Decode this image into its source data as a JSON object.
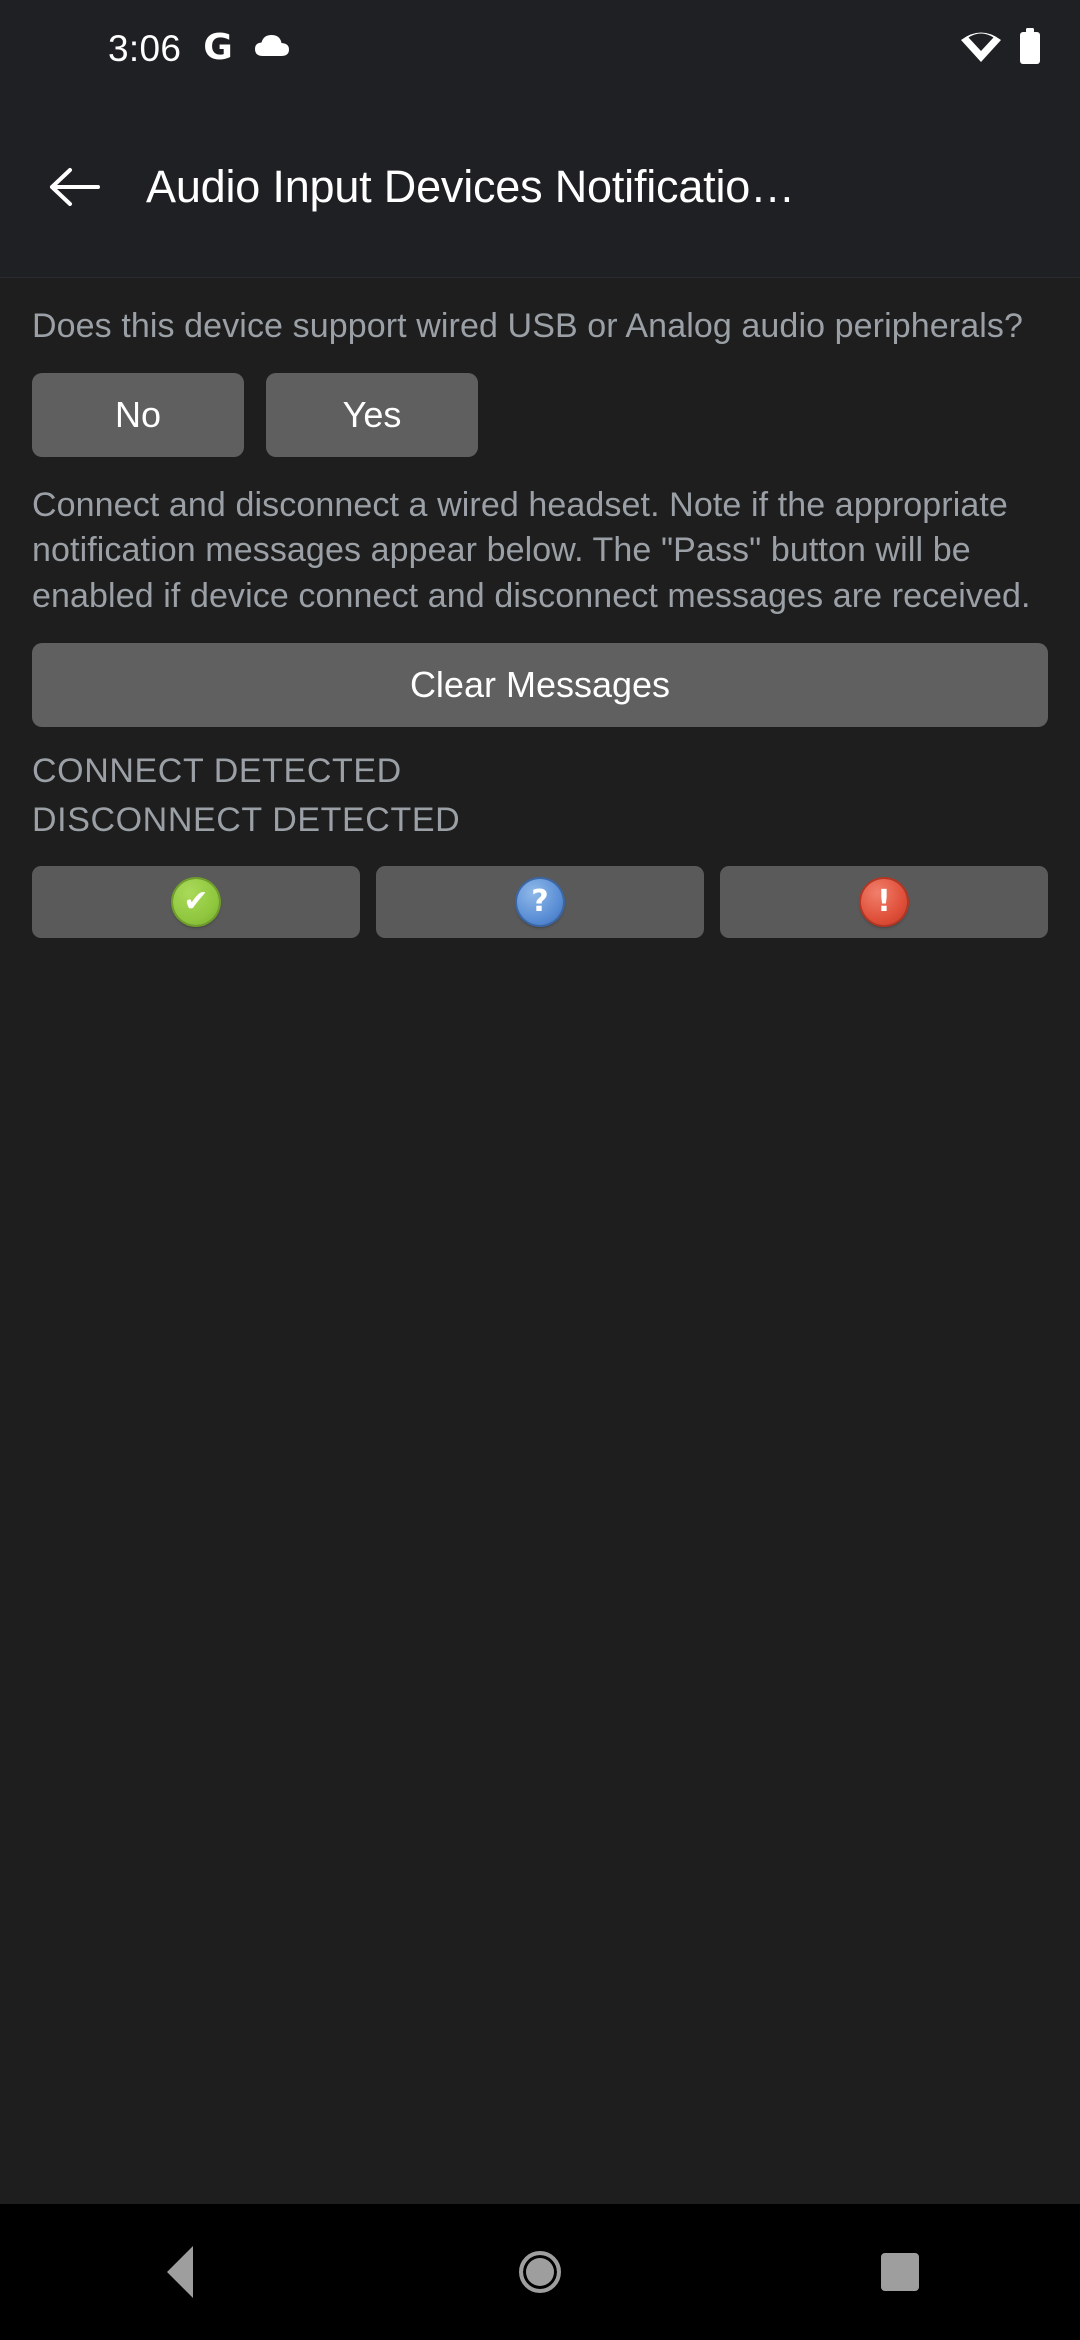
{
  "status_bar": {
    "clock": "3:06",
    "google_icon": "G",
    "icons": [
      "cloud-icon",
      "wifi-icon",
      "battery-icon"
    ]
  },
  "app_bar": {
    "back_icon": "back-arrow-icon",
    "title": "Audio Input Devices Notificatio…"
  },
  "main": {
    "question": "Does this device support wired USB or Analog audio peripherals?",
    "choices": [
      {
        "label": "No"
      },
      {
        "label": "Yes"
      }
    ],
    "instructions": "Connect and disconnect a wired headset. Note if the appropriate notification messages appear below. The \"Pass\" button will be enabled if device connect and disconnect messages are received.",
    "clear_button": "Clear Messages",
    "log_lines": [
      "CONNECT DETECTED",
      "DISCONNECT DETECTED"
    ],
    "verdict_buttons": [
      {
        "icon": "check-icon",
        "glyph": "✔",
        "name": "pass-button"
      },
      {
        "icon": "question-icon",
        "glyph": "?",
        "name": "info-button"
      },
      {
        "icon": "exclamation-icon",
        "glyph": "!",
        "name": "fail-button"
      }
    ]
  },
  "nav_bar": {
    "back": "nav-back-icon",
    "home": "nav-home-icon",
    "recents": "nav-recents-icon"
  },
  "colors": {
    "background": "#1e1e1e",
    "app_bar": "#1e2023",
    "button": "#5f5f5f",
    "text_secondary": "#9aa0a6",
    "pass_green": "#8fc73e",
    "info_blue": "#5b8fd6",
    "fail_red": "#e0503a"
  }
}
